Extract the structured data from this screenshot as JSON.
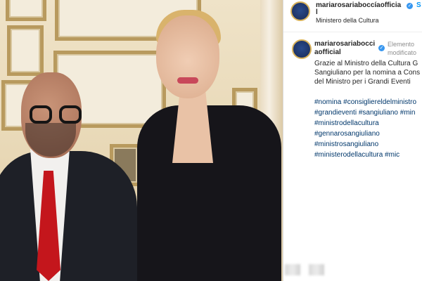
{
  "post": {
    "username": "mariarosariaboccíaofficia",
    "username_cont": "l",
    "follow_label": "S",
    "location": "Ministero della Cultura"
  },
  "comment": {
    "username": "mariarosariabocci aofficial",
    "status": "Elemento modificato",
    "caption": "Grazie al Ministro della Cultura G\nSangiuliano per la nomina a Cons\ndel Ministro per i Grandi Eventi",
    "hashtags": [
      "#nomina #consigliereldelministro",
      "#grandieventi #sangiuliano #min",
      "#ministrodellacultura",
      "#gennarosangiuliano",
      "#ministrosangiuliano",
      "#ministerodellacultura #mic"
    ]
  },
  "colors": {
    "link": "#00376b",
    "follow": "#0095f6",
    "verified": "#3897f0"
  },
  "icons": {
    "verified": "verified-badge-icon",
    "avatar": "profile-avatar"
  }
}
